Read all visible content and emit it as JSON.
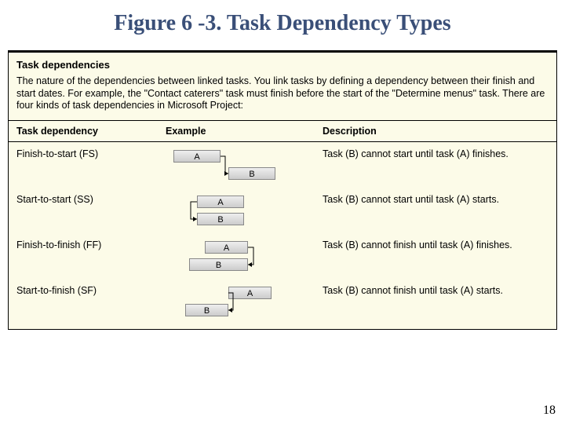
{
  "title": "Figure 6 -3. Task Dependency Types",
  "heading": "Task dependencies",
  "intro": "The nature of the dependencies between linked tasks. You link tasks by defining a dependency between their finish and start dates. For example, the \"Contact caterers\" task must finish before the start of the \"Determine menus\" task. There are four kinds of task dependencies in Microsoft Project:",
  "columns": {
    "dependency": "Task dependency",
    "example": "Example",
    "description": "Description"
  },
  "labels": {
    "a": "A",
    "b": "B"
  },
  "rows": [
    {
      "name": "Finish-to-start (FS)",
      "desc": "Task (B) cannot start until task (A) finishes.",
      "type": "fs"
    },
    {
      "name": "Start-to-start (SS)",
      "desc": "Task (B) cannot start until task (A) starts.",
      "type": "ss"
    },
    {
      "name": "Finish-to-finish (FF)",
      "desc": "Task (B) cannot finish until task (A) finishes.",
      "type": "ff"
    },
    {
      "name": "Start-to-finish (SF)",
      "desc": "Task (B) cannot finish until task (A) starts.",
      "type": "sf"
    }
  ],
  "page_number": "18"
}
